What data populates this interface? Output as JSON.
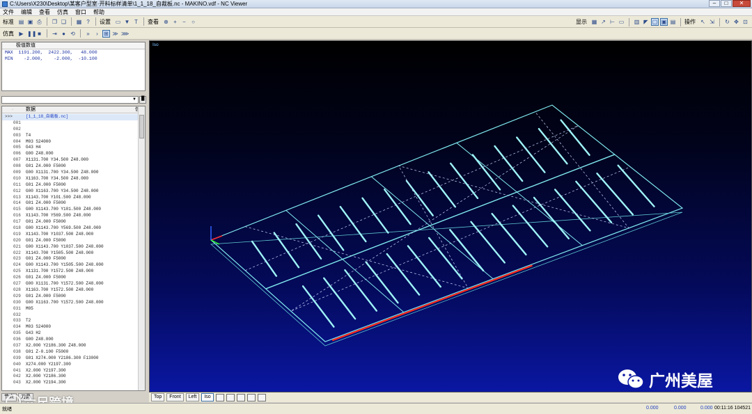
{
  "window": {
    "title": "C:\\Users\\X230\\Desktop\\某客户型室·开料标样清单\\1_1_18_自裁板.nc - MAKINO.vdf - NC Viewer",
    "minimize": "–",
    "maximize": "□",
    "close": "✕"
  },
  "menu": [
    "文件",
    "编辑",
    "查看",
    "仿真",
    "窗口",
    "帮助"
  ],
  "toolbar1": {
    "label_std": "标准",
    "label_settings": "设置",
    "label_view": "查看",
    "label_display": "显示",
    "label_ops": "操作"
  },
  "toolbar2": {
    "label_sim": "仿真"
  },
  "limits": {
    "header": "极值数值",
    "max_row": "MAX  1191.200,  2422.300,   48.000",
    "min_row": "MIN    -2.000,    -2.000,  -10.100"
  },
  "nc": {
    "col_data": "数据",
    "col_info": "信",
    "first_marker": ">>>",
    "first_text": "[1_1_18_自裁板.nc]",
    "rows": [
      [
        "001",
        ""
      ],
      [
        "002",
        ""
      ],
      [
        "003",
        "T4"
      ],
      [
        "004",
        "M03 S24000"
      ],
      [
        "005",
        "G43 H4"
      ],
      [
        "006",
        "G00 Z48.000"
      ],
      [
        "007",
        "X1131.700 Y34.500 Z48.000"
      ],
      [
        "008",
        "G01 Z4.000 F5000"
      ],
      [
        "009",
        "G00 X1131.700 Y34.500 Z48.000"
      ],
      [
        "010",
        "X1163.700 Y34.500 Z48.000"
      ],
      [
        "011",
        "G01 Z4.000 F5000"
      ],
      [
        "012",
        "G00 X1163.700 Y34.500 Z48.000"
      ],
      [
        "013",
        "X1143.700 Y101.500 Z48.000"
      ],
      [
        "014",
        "G01 Z4.000 F5000"
      ],
      [
        "015",
        "G00 X1143.700 Y101.500 Z48.000"
      ],
      [
        "016",
        "X1143.700 Y569.500 Z48.000"
      ],
      [
        "017",
        "G01 Z4.000 F5000"
      ],
      [
        "018",
        "G00 X1143.700 Y569.500 Z48.000"
      ],
      [
        "019",
        "X1143.700 Y1037.500 Z48.000"
      ],
      [
        "020",
        "G01 Z4.000 F5000"
      ],
      [
        "021",
        "G00 X1143.700 Y1037.500 Z48.000"
      ],
      [
        "022",
        "X1143.700 Y1505.500 Z48.000"
      ],
      [
        "023",
        "G01 Z4.000 F5000"
      ],
      [
        "024",
        "G00 X1143.700 Y1505.500 Z48.000"
      ],
      [
        "025",
        "X1131.700 Y1572.500 Z48.000"
      ],
      [
        "026",
        "G01 Z4.000 F5000"
      ],
      [
        "027",
        "G00 X1131.700 Y1572.500 Z48.000"
      ],
      [
        "028",
        "X1163.700 Y1572.500 Z48.000"
      ],
      [
        "029",
        "G01 Z4.000 F5000"
      ],
      [
        "030",
        "G00 X1163.700 Y1572.500 Z48.000"
      ],
      [
        "031",
        "M05"
      ],
      [
        "032",
        ""
      ],
      [
        "033",
        "T2"
      ],
      [
        "034",
        "M03 S24000"
      ],
      [
        "035",
        "G43 H2"
      ],
      [
        "036",
        "G00 Z48.000"
      ],
      [
        "037",
        "X2.000 Y2186.300 Z48.000"
      ],
      [
        "038",
        "G01 Z-0.100 F5000"
      ],
      [
        "039",
        "G01 X274.000 Y2186.300 F13000"
      ],
      [
        "040",
        "X274.000 Y2197.300"
      ],
      [
        "041",
        "X2.000 Y2197.300"
      ],
      [
        "042",
        "X2.000 Y2186.300"
      ],
      [
        "043",
        "X2.000 Y2194.300"
      ]
    ]
  },
  "left_tabs": [
    "节点",
    "刀具"
  ],
  "viewport": {
    "label": "Iso"
  },
  "view_tabs": [
    "Top",
    "Front",
    "Left",
    "Iso"
  ],
  "watermark": {
    "brand": "广州美屋",
    "brand2": "六尺跨境"
  },
  "status": {
    "label": "就绪",
    "x": "0.000",
    "y": "0.000",
    "z": "0.000",
    "time": "00:11:16 104521"
  }
}
